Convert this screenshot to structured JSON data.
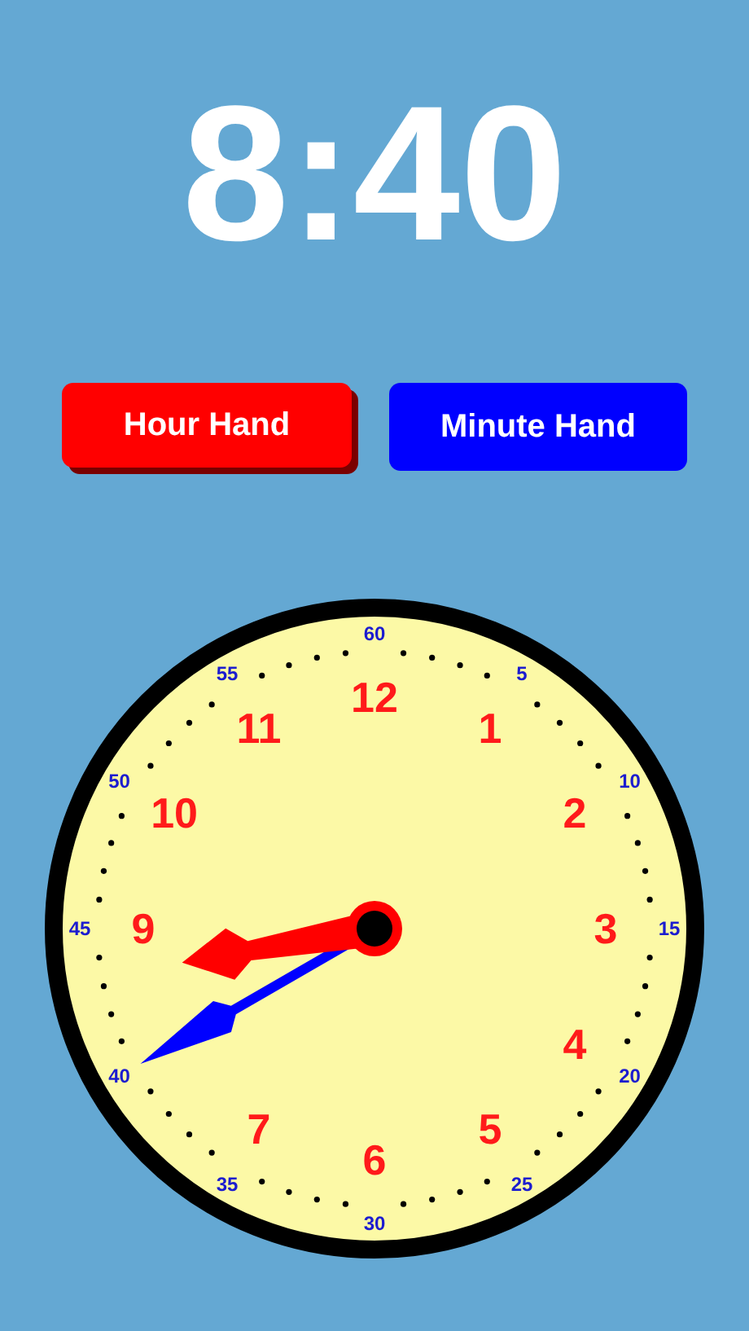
{
  "time": "8:40",
  "buttons": [
    {
      "label": "Hour Hand",
      "color": "#ff0000",
      "selected": true
    },
    {
      "label": "Minute Hand",
      "color": "#0000ff",
      "selected": false
    }
  ],
  "clock": {
    "hour_numbers_12_to_7": [
      "12",
      "1",
      "2",
      "3",
      "4",
      "5",
      "6",
      "7"
    ],
    "hour_numbers_9_to_11": [
      "9",
      "10",
      "11"
    ],
    "minute_numbers": [
      "60",
      "5",
      "10",
      "15",
      "20",
      "25",
      "30",
      "35",
      "40",
      "45",
      "50",
      "55"
    ]
  }
}
